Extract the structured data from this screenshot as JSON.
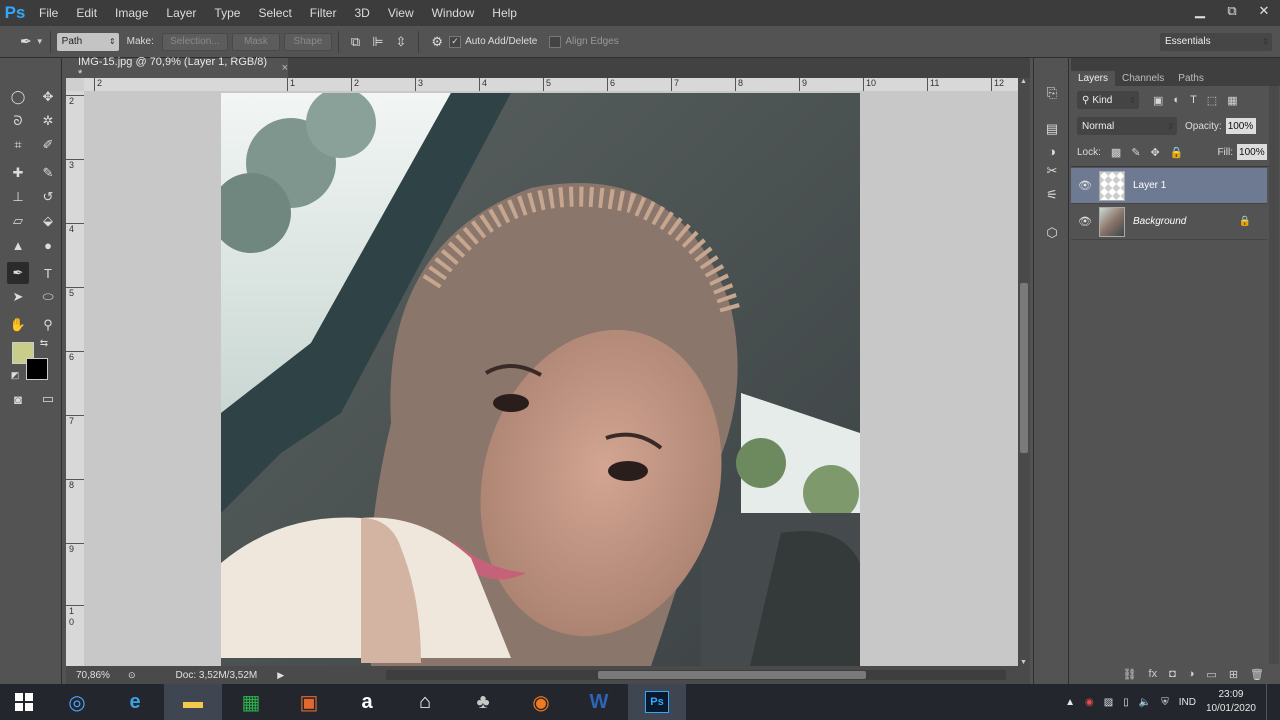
{
  "app": {
    "logo": "Ps"
  },
  "menu": [
    "File",
    "Edit",
    "Image",
    "Layer",
    "Type",
    "Select",
    "Filter",
    "3D",
    "View",
    "Window",
    "Help"
  ],
  "window_controls": {
    "minimize": "▁",
    "restore": "⧉",
    "close": "✕"
  },
  "options": {
    "mode_select": "Path",
    "make_label": "Make:",
    "selection_btn": "Selection...",
    "mask_btn": "Mask",
    "shape_btn": "Shape",
    "auto_add_delete": "Auto Add/Delete",
    "auto_add_checked": true,
    "align_edges": "Align Edges",
    "workspace": "Essentials"
  },
  "document": {
    "tab_title": "IMG-15.jpg @ 70,9% (Layer 1, RGB/8) *",
    "close": "×",
    "ruler_h": [
      "2",
      "1",
      "2",
      "3",
      "4",
      "5",
      "6",
      "7",
      "8",
      "9",
      "10",
      "11",
      "12"
    ],
    "ruler_v": [
      "2",
      "3",
      "4",
      "5",
      "6",
      "7",
      "8",
      "9",
      "1",
      "0"
    ]
  },
  "status": {
    "zoom": "70,86%",
    "doc": "Doc: 3,52M/3,52M"
  },
  "colors": {
    "foreground": "#c9cd8a",
    "background": "#000000"
  },
  "layers_panel": {
    "tabs": [
      "Layers",
      "Channels",
      "Paths"
    ],
    "kind": "Kind",
    "blend_mode": "Normal",
    "opacity_label": "Opacity:",
    "opacity": "100%",
    "lock_label": "Lock:",
    "fill_label": "Fill:",
    "fill": "100%",
    "layers": [
      {
        "name": "Layer 1",
        "selected": true
      },
      {
        "name": "Background",
        "selected": false,
        "locked": true
      }
    ]
  },
  "taskbar": {
    "lang": "IND",
    "time": "23:09",
    "date": "10/01/2020"
  }
}
